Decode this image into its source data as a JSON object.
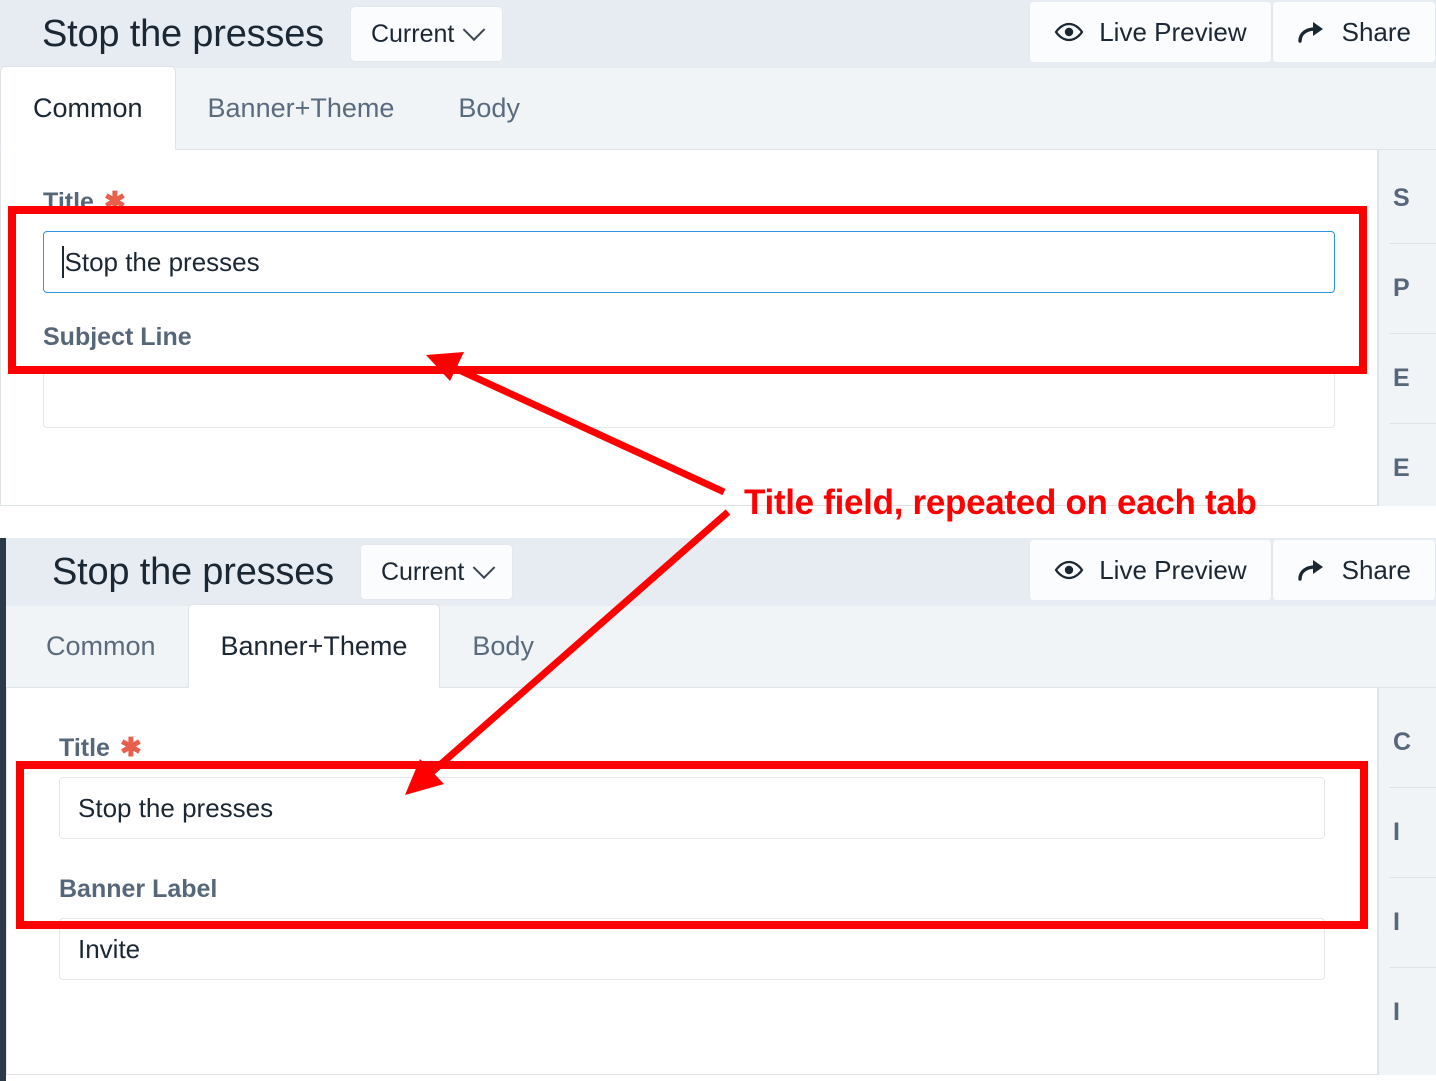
{
  "panels": [
    {
      "id": "panel-common",
      "app_title": "Stop the presses",
      "version_label": "Current",
      "actions": [
        {
          "label": "Live Preview",
          "icon": "eye-icon"
        },
        {
          "label": "Share",
          "icon": "share-arrow-icon"
        }
      ],
      "tabs": [
        {
          "label": "Common",
          "active": true
        },
        {
          "label": "Banner+Theme",
          "active": false
        },
        {
          "label": "Body",
          "active": false
        }
      ],
      "fields": [
        {
          "label": "Title",
          "required": true,
          "value": "Stop the presses",
          "placeholder": "",
          "focused": true,
          "highlighted": true
        },
        {
          "label": "Subject Line",
          "required": false,
          "value": "",
          "placeholder": "",
          "focused": false,
          "highlighted": false
        }
      ],
      "rail_items": [
        "S",
        "P",
        "E",
        "E"
      ]
    },
    {
      "id": "panel-banner",
      "app_title": "Stop the presses",
      "version_label": "Current",
      "actions": [
        {
          "label": "Live Preview",
          "icon": "eye-icon"
        },
        {
          "label": "Share",
          "icon": "share-arrow-icon"
        }
      ],
      "tabs": [
        {
          "label": "Common",
          "active": false
        },
        {
          "label": "Banner+Theme",
          "active": true
        },
        {
          "label": "Body",
          "active": false
        }
      ],
      "fields": [
        {
          "label": "Title",
          "required": true,
          "value": "Stop the presses",
          "placeholder": "",
          "focused": false,
          "highlighted": true
        },
        {
          "label": "Banner Label",
          "required": false,
          "value": "Invite",
          "placeholder": "",
          "focused": false,
          "highlighted": false
        }
      ],
      "rail_items": [
        "C",
        "I",
        "I",
        "I"
      ]
    }
  ],
  "annotation": {
    "text": "Title field, repeated on each tab",
    "color": "#ff0000"
  },
  "colors": {
    "header_bg": "#e7ecf3",
    "tabstrip_bg": "#f1f4f7",
    "card_bg": "#ffffff",
    "label_text": "#57677a",
    "title_text": "#1b2733",
    "required_star": "#e8604c",
    "focus_border": "#2b97e0",
    "annotation": "#ff0000"
  }
}
